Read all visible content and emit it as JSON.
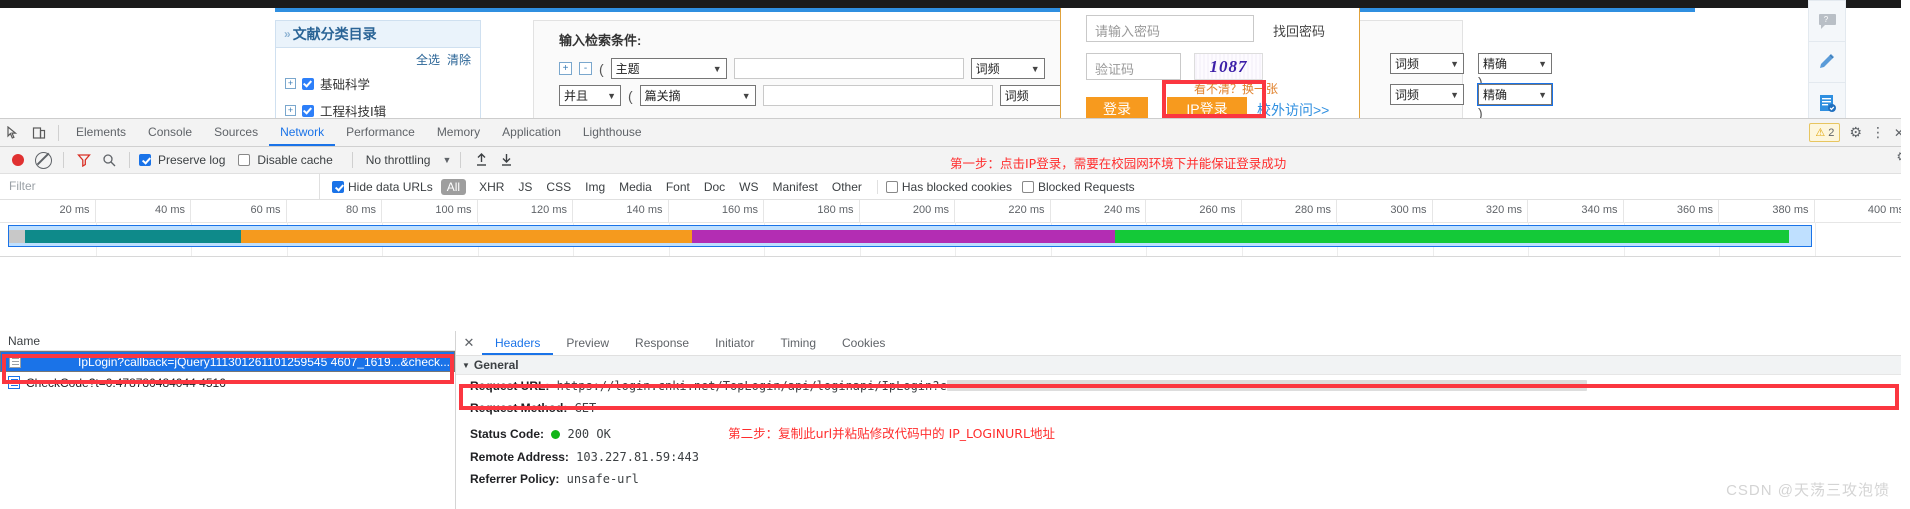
{
  "webpage": {
    "category_panel": {
      "title": "文献分类目录",
      "chevron": "»",
      "select_all": "全选",
      "clear": "清除",
      "items": [
        {
          "label": "基础科学",
          "checked": true
        },
        {
          "label": "工程科技Ⅰ辑",
          "checked": true
        }
      ]
    },
    "search_panel": {
      "title": "输入检索条件:",
      "rows": [
        {
          "logic": "",
          "field": "主题",
          "value": "",
          "freq": "词频",
          "match": "精确"
        },
        {
          "logic": "并且",
          "field": "篇关摘",
          "value": "",
          "freq": "词频",
          "match": "精确"
        }
      ],
      "plus": "+",
      "minus": "-",
      "paren_open": "(",
      "paren_close": ")"
    },
    "login_popup": {
      "password_placeholder": "请输入密码",
      "forgot_password": "找回密码",
      "captcha_placeholder": "验证码",
      "captcha_text": "1087",
      "refresh_hint": "看不清？换一张",
      "login_button": "登录",
      "ip_login_button": "IP登录",
      "off_campus_link": "校外访问>>"
    },
    "float_toolbar": [
      "feedback-icon",
      "edit-icon",
      "notes-icon"
    ]
  },
  "devtools": {
    "tabs": [
      "Elements",
      "Console",
      "Sources",
      "Network",
      "Performance",
      "Memory",
      "Application",
      "Lighthouse"
    ],
    "active_tab": "Network",
    "left_icons": [
      "inspect-icon",
      "device-toolbar-icon"
    ],
    "right": {
      "warning_count": "2",
      "warning_glyph": "⚠",
      "settings_glyph": "⚙",
      "more_glyph": "⋮",
      "close_glyph": "✕"
    },
    "toolbar": {
      "record_tooltip": "record-button",
      "clear_tooltip": "clear-button",
      "filter_tooltip": "filter-button",
      "search_tooltip": "search-button",
      "preserve_log": "Preserve log",
      "preserve_log_checked": true,
      "disable_cache": "Disable cache",
      "disable_cache_checked": false,
      "throttling": "No throttling",
      "throttle_arrow": "▼",
      "import_glyph": "↑",
      "export_glyph": "↓",
      "annotation_step1": "第一步：点击IP登录，需要在校园网环境下并能保证登录成功"
    },
    "filterbar": {
      "placeholder": "Filter",
      "hide_data_urls": "Hide data URLs",
      "hide_data_urls_checked": true,
      "types": [
        "All",
        "XHR",
        "JS",
        "CSS",
        "Img",
        "Media",
        "Font",
        "Doc",
        "WS",
        "Manifest",
        "Other"
      ],
      "active_type": "All",
      "has_blocked_cookies": "Has blocked cookies",
      "blocked_requests": "Blocked Requests"
    },
    "timeline": {
      "ticks": [
        "20 ms",
        "40 ms",
        "60 ms",
        "80 ms",
        "100 ms",
        "120 ms",
        "140 ms",
        "160 ms",
        "180 ms",
        "200 ms",
        "220 ms",
        "240 ms",
        "260 ms",
        "280 ms",
        "300 ms",
        "320 ms",
        "340 ms",
        "360 ms",
        "380 ms",
        "400 ms"
      ],
      "bands": [
        {
          "color": "#c8c8c8",
          "start_pct": 0.0,
          "width_pct": 0.9
        },
        {
          "color": "#0e8a8a",
          "start_pct": 0.9,
          "width_pct": 12.0
        },
        {
          "color": "#f59a1e",
          "start_pct": 12.9,
          "width_pct": 25.0
        },
        {
          "color": "#b32db3",
          "start_pct": 37.9,
          "width_pct": 23.5
        },
        {
          "color": "#14c938",
          "start_pct": 61.4,
          "width_pct": 37.4
        }
      ]
    },
    "requests": {
      "column_header": "Name",
      "rows": [
        {
          "name": "IpLogin?callback=jQuery111301261101259545 4607_1619...&check...",
          "selected": true
        },
        {
          "name": "CheckCode?t=0.478780484044 4516",
          "selected": false
        }
      ]
    },
    "details": {
      "tabs": [
        "Headers",
        "Preview",
        "Response",
        "Initiator",
        "Timing",
        "Cookies"
      ],
      "active_tab": "Headers",
      "close_glyph": "✕",
      "section": "General",
      "section_arrow": "▼",
      "fields": [
        {
          "key": "Request URL:",
          "value": "https://login.cnki.net/TopLogin/api/loginapi/IpLogin?c",
          "redacted": true
        },
        {
          "key": "Request Method:",
          "value": "GET"
        },
        {
          "key": "Status Code:",
          "value": "200 OK",
          "status_dot": "#12b518"
        },
        {
          "key": "Remote Address:",
          "value": "103.227.81.59:443"
        },
        {
          "key": "Referrer Policy:",
          "value": "unsafe-url"
        }
      ],
      "annotation_step2": "第二步：复制此url并粘贴修改代码中的 IP_LOGINURL地址"
    }
  },
  "watermark": "CSDN @天荡三攻泡馈",
  "colors": {
    "accent_blue": "#1a73e8",
    "annotation_red": "#ff2d2d",
    "redbox_red": "#fb3640",
    "orange_button": "#f79a1e",
    "status_green": "#12b518"
  }
}
